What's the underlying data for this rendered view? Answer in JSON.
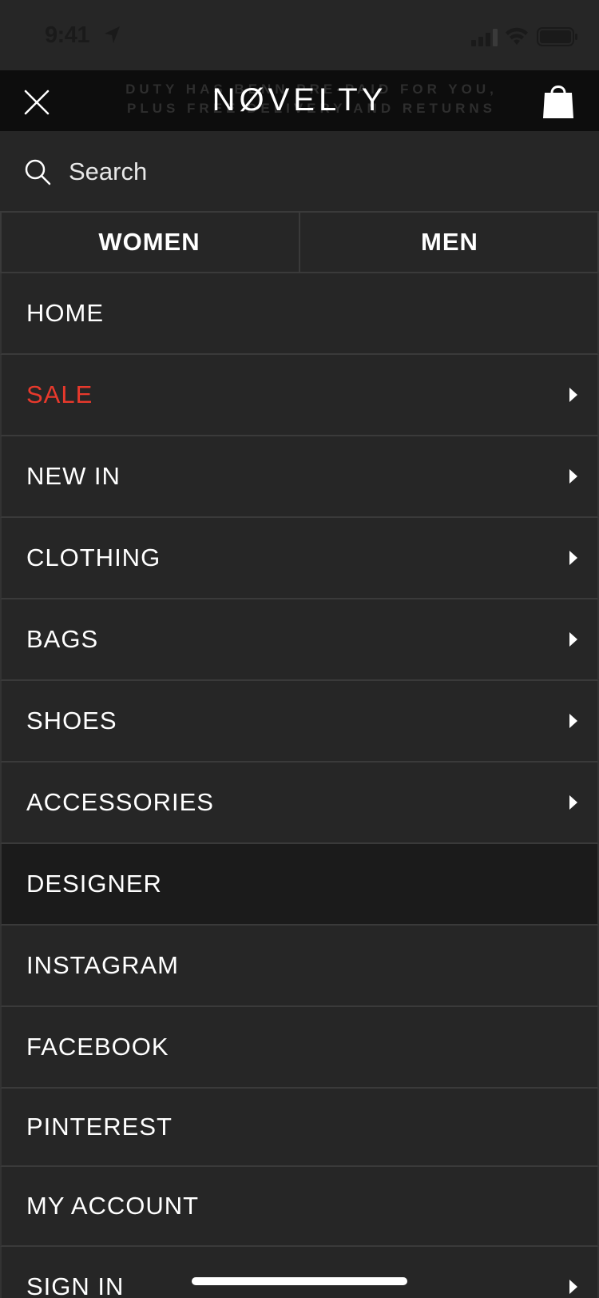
{
  "status_bar": {
    "time": "9:41",
    "location_icon": "location-arrow-icon",
    "signal_icon": "cellular-signal-icon",
    "wifi_icon": "wifi-icon",
    "battery_icon": "battery-icon"
  },
  "header": {
    "promo_line1": "DUTY HAS BENN PRE-PAID FOR YOU,",
    "promo_line2": "PLUS FREE DELIVERY AND RETURNS",
    "logo": "NØVELTY",
    "close_icon": "close-icon",
    "bag_icon": "shopping-bag-icon"
  },
  "search": {
    "placeholder": "Search",
    "icon": "search-icon"
  },
  "tabs": [
    {
      "label": "WOMEN"
    },
    {
      "label": "MEN"
    }
  ],
  "menu": {
    "items": [
      {
        "label": "HOME",
        "has_arrow": false
      },
      {
        "label": "SALE",
        "has_arrow": true
      },
      {
        "label": "NEW IN",
        "has_arrow": true
      },
      {
        "label": "CLOTHING",
        "has_arrow": true
      },
      {
        "label": "BAGS",
        "has_arrow": true
      },
      {
        "label": "SHOES",
        "has_arrow": true
      },
      {
        "label": "ACCESSORIES",
        "has_arrow": true
      },
      {
        "label": "DESIGNER",
        "has_arrow": false
      },
      {
        "label": "INSTAGRAM",
        "has_arrow": false
      },
      {
        "label": "FACEBOOK",
        "has_arrow": false
      },
      {
        "label": "PINTEREST",
        "has_arrow": false
      },
      {
        "label": "MY ACCOUNT",
        "has_arrow": false
      },
      {
        "label": "SIGN IN",
        "has_arrow": true
      }
    ],
    "arrow_icon": "chevron-right-icon"
  },
  "colors": {
    "background": "#262626",
    "header_background": "#0d0d0d",
    "sale_red": "#e8392c",
    "active_row": "#1b1b1b",
    "divider": "#3a3a3a"
  }
}
